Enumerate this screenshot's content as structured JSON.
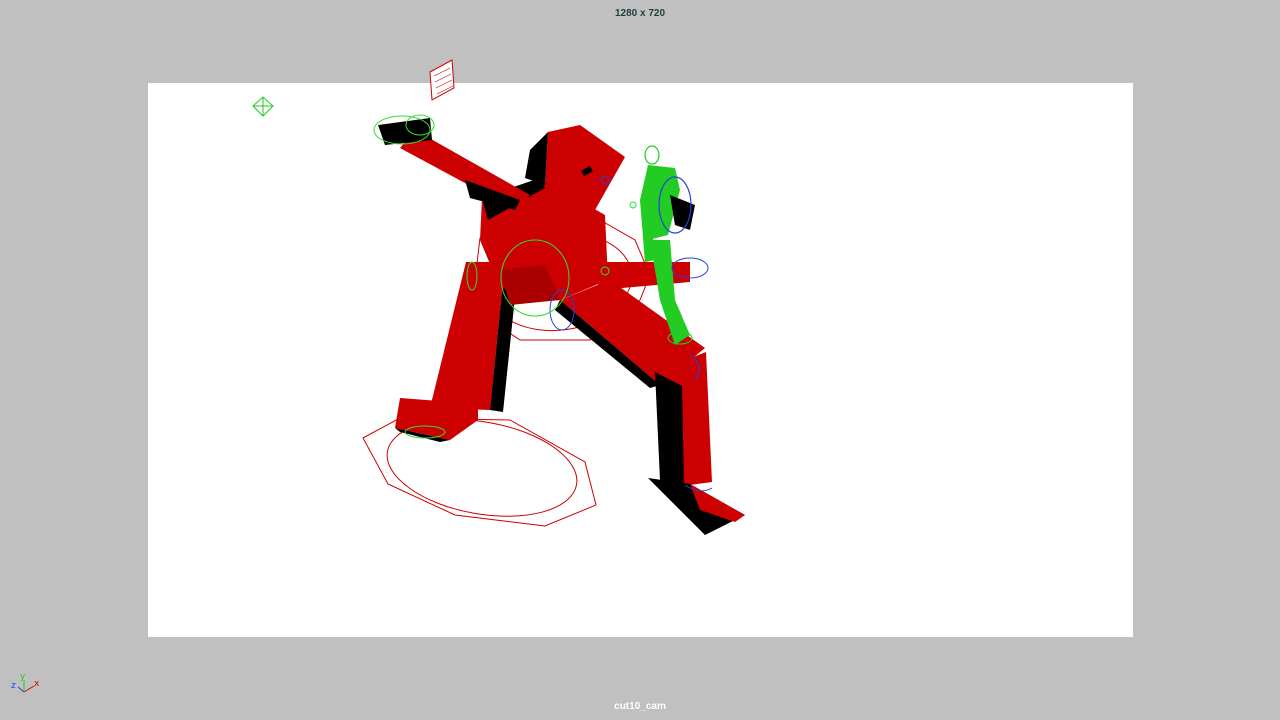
{
  "viewport": {
    "resolution_label": "1280 x 720",
    "camera_name": "cut10_cam"
  },
  "axis": {
    "x_label": "x",
    "y_label": "y",
    "z_label": "z"
  },
  "colors": {
    "background": "#c0c0c0",
    "resolution_gate": "#ffffff",
    "character_main": "#cc0000",
    "character_shadow": "#000000",
    "character_small": "#22cc22",
    "nurbs_control": "#dd0000",
    "ik_control": "#2244dd",
    "selection_control": "#33dd33"
  },
  "icons": {
    "axis_gizmo": "xyz-axis-icon",
    "light": "point-light-icon",
    "locator": "locator-icon"
  }
}
